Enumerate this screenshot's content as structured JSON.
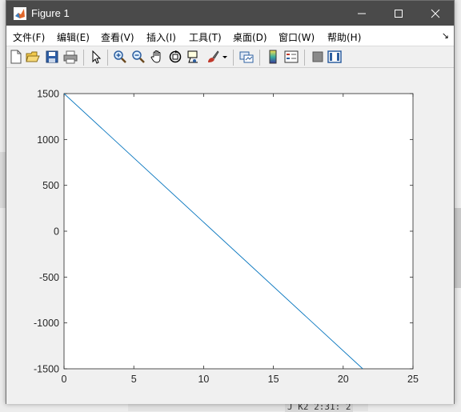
{
  "window": {
    "title": "Figure 1",
    "controls": [
      "minimize-icon",
      "maximize-icon",
      "close-icon"
    ]
  },
  "menu": {
    "items": [
      {
        "label": "文件(F)"
      },
      {
        "label": "编辑(E)"
      },
      {
        "label": "查看(V)"
      },
      {
        "label": "插入(I)"
      },
      {
        "label": "工具(T)"
      },
      {
        "label": "桌面(D)"
      },
      {
        "label": "窗口(W)"
      },
      {
        "label": "帮助(H)"
      }
    ],
    "overflow_icon": "dock-arrow-icon"
  },
  "toolbar": {
    "icons": [
      "new-figure-icon",
      "open-file-icon",
      "save-icon",
      "print-icon",
      "edit-plot-arrow-icon",
      "zoom-in-icon",
      "zoom-out-icon",
      "pan-hand-icon",
      "rotate-3d-icon",
      "data-cursor-icon",
      "brush-icon",
      "brush-dropdown-icon",
      "link-plot-icon",
      "colorbar-icon",
      "legend-icon",
      "hide-plot-tools-icon",
      "show-plot-tools-icon"
    ]
  },
  "colors": {
    "titlebar": "#4a4a4a",
    "line": "#0072bd",
    "axes_bg": "#ffffff",
    "figure_bg": "#f0f0f0"
  },
  "background": {
    "bottom_text": "J K2 2:31: 2"
  },
  "chart_data": {
    "type": "line",
    "title": "",
    "xlabel": "",
    "ylabel": "",
    "xlim": [
      0,
      25
    ],
    "ylim": [
      -1500,
      1500
    ],
    "xticks": [
      "0",
      "5",
      "10",
      "15",
      "20",
      "25"
    ],
    "yticks": [
      "1500",
      "1000",
      "500",
      "0",
      "-500",
      "-1000",
      "-1500"
    ],
    "grid": false,
    "series": [
      {
        "x": [
          0,
          21.4
        ],
        "y": [
          1500,
          -1500
        ]
      }
    ]
  }
}
